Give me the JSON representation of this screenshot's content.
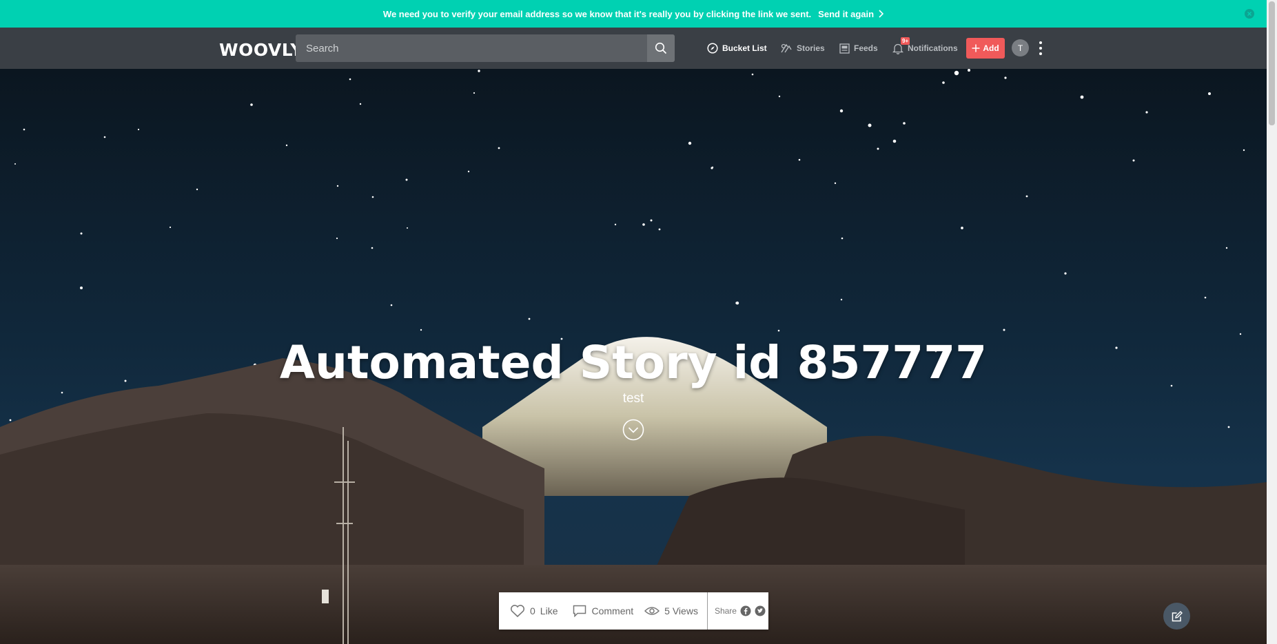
{
  "banner": {
    "message": "We need you to verify your email address so we know that it's really you by clicking the link we sent.",
    "resend_label": "Send it again"
  },
  "nav": {
    "logo": "WOOVLY",
    "search_placeholder": "Search",
    "bucket_list": "Bucket List",
    "stories": "Stories",
    "feeds": "Feeds",
    "notifications": "Notifications",
    "notifications_badge": "9+",
    "add": "Add",
    "avatar_initial": "T"
  },
  "story": {
    "title": "Automated Story id 857777",
    "subtitle": "test"
  },
  "actions": {
    "like_count": "0",
    "like_label": "Like",
    "comment_label": "Comment",
    "views": "5 Views",
    "share_label": "Share"
  },
  "colors": {
    "banner": "#00d1b2",
    "nav": "#3a3f45",
    "accent": "#f05a5a"
  }
}
